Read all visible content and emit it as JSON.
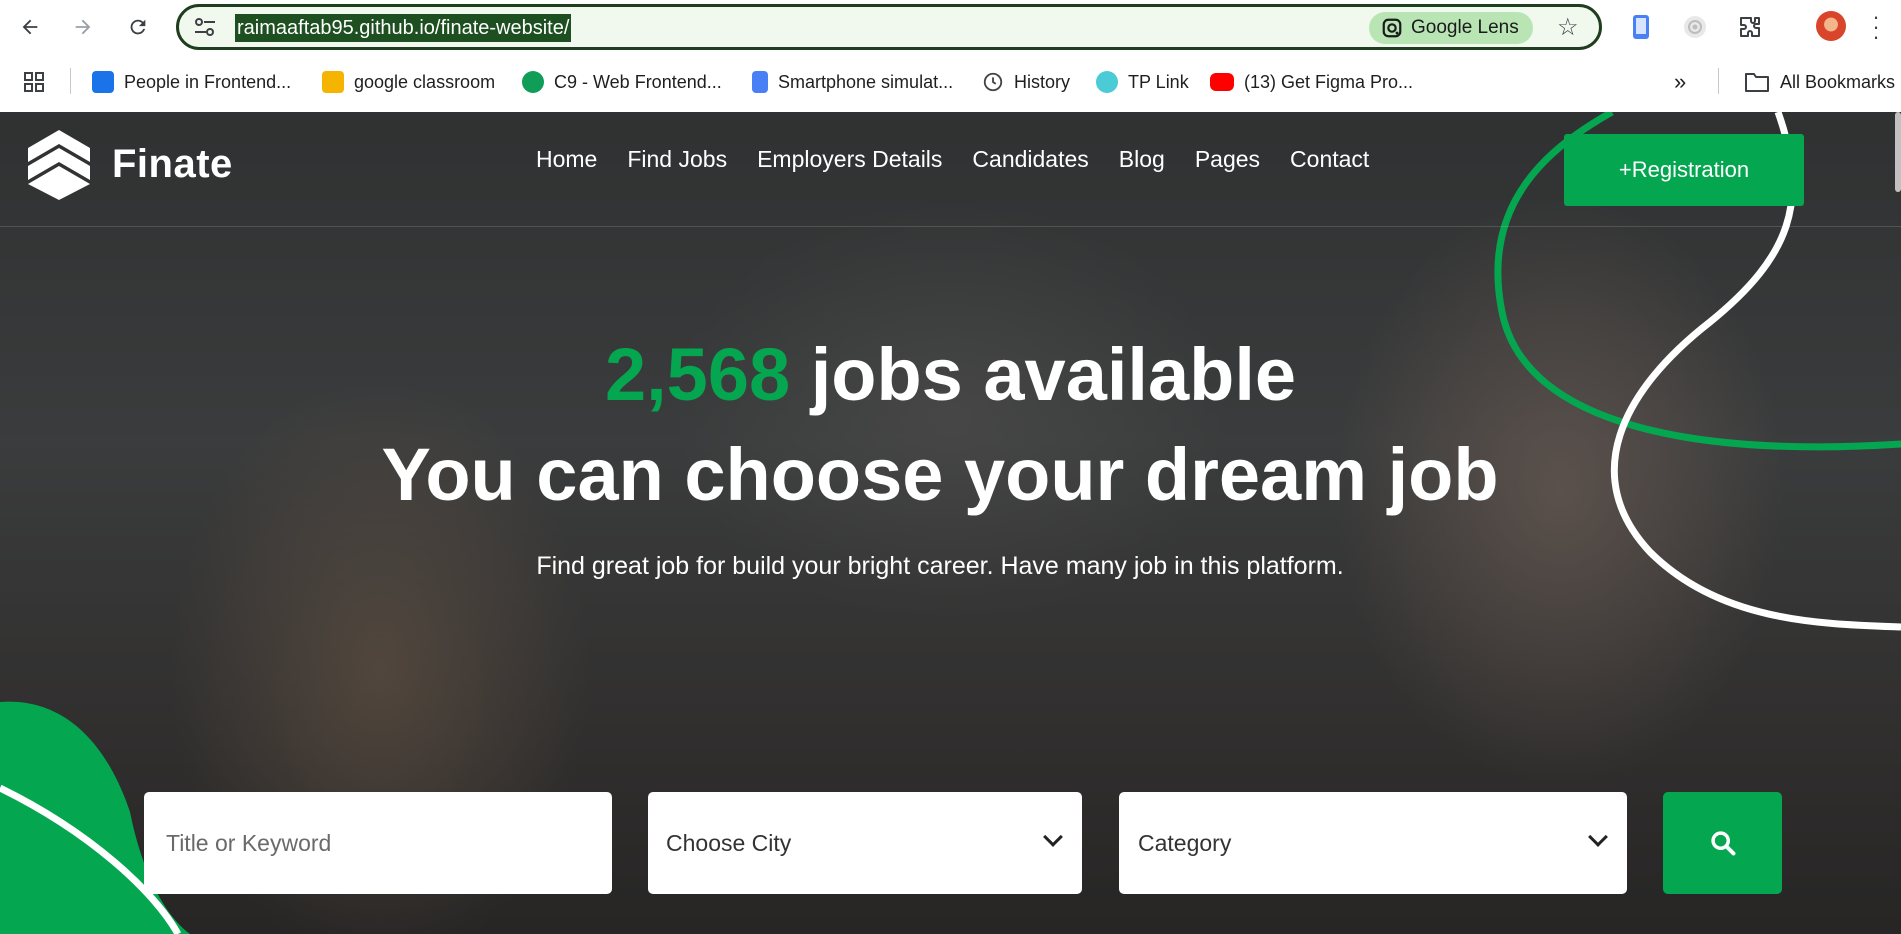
{
  "browser": {
    "url": "raimaaftab95.github.io/finate-website/",
    "lens_label": "Google Lens",
    "bookmarks": [
      {
        "label": "People in Frontend...",
        "icon": "people-icon",
        "color": "#1a73e8"
      },
      {
        "label": "google classroom",
        "icon": "classroom-icon",
        "color": "#f4b400"
      },
      {
        "label": "C9 - Web Frontend...",
        "icon": "chat-icon",
        "color": "#0f9d58"
      },
      {
        "label": "Smartphone simulat...",
        "icon": "phone-icon",
        "color": "#4a80f5"
      },
      {
        "label": "History",
        "icon": "history-icon",
        "color": "#444444"
      },
      {
        "label": "TP Link",
        "icon": "tplink-icon",
        "color": "#4acbd6"
      },
      {
        "label": "(13) Get Figma Pro...",
        "icon": "youtube-icon",
        "color": "#ff0000"
      }
    ],
    "all_bookmarks_label": "All Bookmarks"
  },
  "site": {
    "logo_text": "Finate",
    "menu": [
      "Home",
      "Find Jobs",
      "Employers Details",
      "Candidates",
      "Blog",
      "Pages",
      "Contact"
    ],
    "register_label": "+Registration",
    "accent_color": "#05a650"
  },
  "hero": {
    "job_count": "2,568",
    "headline_rest": " jobs available",
    "headline2": "You can choose your dream job",
    "subtitle": "Find great job for build your bright career. Have many job in this platform."
  },
  "search": {
    "keyword_placeholder": "Title or Keyword",
    "city_label": "Choose City",
    "category_label": "Category"
  }
}
